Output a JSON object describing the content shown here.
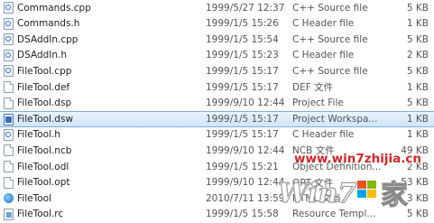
{
  "files": [
    {
      "name": "Commands.cpp",
      "date": "1999/5/27 12:37",
      "type": "C++ Source file",
      "size": "5 KB",
      "icon": "cpp-file-icon"
    },
    {
      "name": "Commands.h",
      "date": "1999/1/5 15:26",
      "type": "C Header file",
      "size": "1 KB",
      "icon": "header-file-icon"
    },
    {
      "name": "DSAddIn.cpp",
      "date": "1999/1/5 15:54",
      "type": "C++ Source file",
      "size": "5 KB",
      "icon": "cpp-file-icon"
    },
    {
      "name": "DSAddIn.h",
      "date": "1999/1/5 15:23",
      "type": "C Header file",
      "size": "2 KB",
      "icon": "header-file-icon"
    },
    {
      "name": "FileTool.cpp",
      "date": "1999/1/5 15:17",
      "type": "C++ Source file",
      "size": "5 KB",
      "icon": "cpp-file-icon"
    },
    {
      "name": "FileTool.def",
      "date": "1999/1/5 15:17",
      "type": "DEF 文件",
      "size": "1 KB",
      "icon": "file-icon"
    },
    {
      "name": "FileTool.dsp",
      "date": "1999/9/10 12:44",
      "type": "Project File",
      "size": "5 KB",
      "icon": "file-icon"
    },
    {
      "name": "FileTool.dsw",
      "date": "1999/1/5 15:17",
      "type": "Project Workspa...",
      "size": "1 KB",
      "icon": "workspace-file-icon"
    },
    {
      "name": "FileTool.h",
      "date": "1999/1/5 15:17",
      "type": "C Header file",
      "size": "1 KB",
      "icon": "header-file-icon"
    },
    {
      "name": "FileTool.ncb",
      "date": "1999/9/10 12:44",
      "type": "NCB 文件",
      "size": "49 KB",
      "icon": "file-icon"
    },
    {
      "name": "FileTool.odl",
      "date": "1999/1/5 15:21",
      "type": "Object Definition...",
      "size": "2 KB",
      "icon": "file-icon"
    },
    {
      "name": "FileTool.opt",
      "date": "1999/9/10 12:44",
      "type": "OPT 文件",
      "size": "53 KB",
      "icon": "file-icon"
    },
    {
      "name": "FileTool",
      "date": "2010/7/11 13:59",
      "type": "HTML 文档",
      "size": "3 KB",
      "icon": "html-file-icon"
    },
    {
      "name": "FileTool.rc",
      "date": "1999/1/5 15:58",
      "type": "Resource Templ...",
      "size": "5 KB",
      "icon": "resource-file-icon"
    }
  ],
  "selected_index": 7,
  "watermark": {
    "url": "www.win7zhijia.cn",
    "logo": "Win7系统之家"
  },
  "colors": {
    "selection_top": "#e8f3fd",
    "selection_bottom": "#cfe6fb",
    "selection_border": "#84acdd",
    "watermark_red": "#d3262a"
  }
}
